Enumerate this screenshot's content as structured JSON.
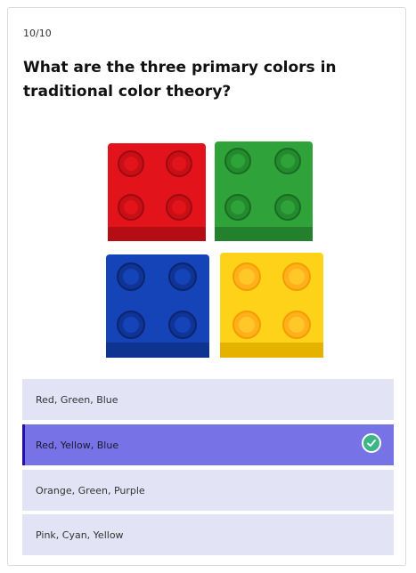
{
  "quiz": {
    "progress": "10/10",
    "question": "What are the three primary colors in traditional color theory?",
    "image": {
      "description_icon": "lego-bricks-image",
      "bricks": [
        {
          "name": "red-brick",
          "color": "#e3131b"
        },
        {
          "name": "green-brick",
          "color": "#2fa33a"
        },
        {
          "name": "blue-brick",
          "color": "#1544b8"
        },
        {
          "name": "yellow-brick",
          "color": "#ffd21a"
        }
      ]
    },
    "answers": [
      {
        "label": "Red, Green, Blue",
        "selected": false
      },
      {
        "label": "Red, Yellow, Blue",
        "selected": true
      },
      {
        "label": "Orange, Green, Purple",
        "selected": false
      },
      {
        "label": "Pink, Cyan, Yellow",
        "selected": false
      }
    ],
    "colors": {
      "answer_bg": "#e3e3f6",
      "selected_bg": "#7773e6",
      "selected_border": "#1f10b4",
      "check_green": "#3cb589"
    },
    "check_icon": "check-circle-icon"
  }
}
